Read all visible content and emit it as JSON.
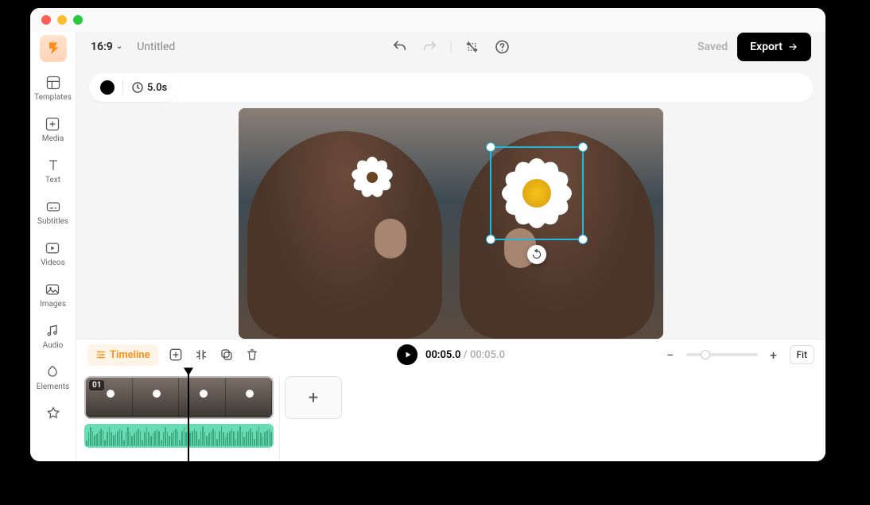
{
  "header": {
    "aspect_ratio": "16:9",
    "title": "Untitled",
    "saved_label": "Saved",
    "export_label": "Export"
  },
  "infobar": {
    "color_swatch": "#000000",
    "duration": "5.0s"
  },
  "sidebar": {
    "items": [
      {
        "label": "Templates",
        "icon": "templates"
      },
      {
        "label": "Media",
        "icon": "media"
      },
      {
        "label": "Text",
        "icon": "text"
      },
      {
        "label": "Subtitles",
        "icon": "subtitles"
      },
      {
        "label": "Videos",
        "icon": "videos"
      },
      {
        "label": "Images",
        "icon": "images"
      },
      {
        "label": "Audio",
        "icon": "audio"
      },
      {
        "label": "Elements",
        "icon": "elements"
      }
    ]
  },
  "bottombar": {
    "timeline_label": "Timeline",
    "current_time": "00:05.0",
    "total_time": "00:05.0",
    "fit_label": "Fit"
  },
  "timeline": {
    "clip_label": "01",
    "add_label": "+"
  }
}
